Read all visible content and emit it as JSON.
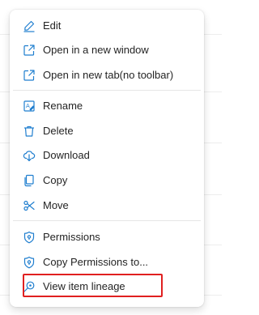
{
  "menu": {
    "items": [
      {
        "label": "Edit",
        "icon": "pencil-icon"
      },
      {
        "label": "Open in a new window",
        "icon": "open-external-icon"
      },
      {
        "label": "Open in new tab(no toolbar)",
        "icon": "open-external-icon"
      },
      {
        "label": "Rename",
        "icon": "rename-icon"
      },
      {
        "label": "Delete",
        "icon": "trash-icon"
      },
      {
        "label": "Download",
        "icon": "cloud-download-icon"
      },
      {
        "label": "Copy",
        "icon": "copy-icon"
      },
      {
        "label": "Move",
        "icon": "scissors-icon"
      },
      {
        "label": "Permissions",
        "icon": "shield-icon"
      },
      {
        "label": "Copy Permissions to...",
        "icon": "shield-icon"
      },
      {
        "label": "View item lineage",
        "icon": "lineage-search-icon"
      }
    ]
  },
  "colors": {
    "icon": "#1f7ecf",
    "text": "#242424",
    "highlight_border": "#e02020"
  }
}
